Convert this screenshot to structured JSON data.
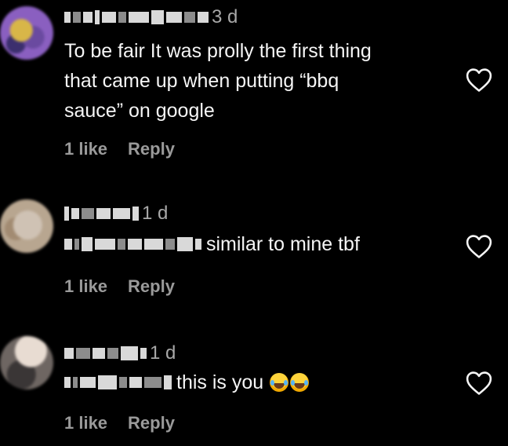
{
  "comments": [
    {
      "time": "3 d",
      "text": "To be fair It was prolly the first thing\nthat came up when putting “bbq\nsauce” on google",
      "likes": "1 like",
      "reply": "Reply"
    },
    {
      "time": "1 d",
      "text": "similar to mine tbf",
      "likes": "1 like",
      "reply": "Reply"
    },
    {
      "time": "1 d",
      "text": "this is you",
      "emoji": "😂😂",
      "likes": "1 like",
      "reply": "Reply"
    }
  ],
  "icons": {
    "like": "heart-outline-icon"
  },
  "colors": {
    "background": "#000000",
    "primary_text": "#f5f5f5",
    "secondary_text": "#a8a8a8",
    "action_text": "#9a9a9a"
  }
}
